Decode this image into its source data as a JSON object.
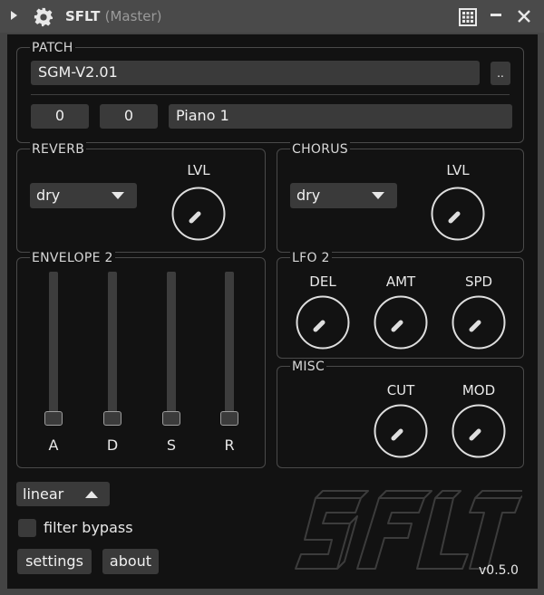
{
  "window": {
    "title": "SFLT",
    "subtitle": "(Master)"
  },
  "patch": {
    "label": "PATCH",
    "name": "SGM-V2.01",
    "browse_label": "..",
    "bank": "0",
    "program": "0",
    "preset_name": "Piano 1"
  },
  "reverb": {
    "label": "REVERB",
    "mode": "dry",
    "knob_label": "LVL"
  },
  "chorus": {
    "label": "CHORUS",
    "mode": "dry",
    "knob_label": "LVL"
  },
  "envelope": {
    "label": "ENVELOPE 2",
    "sliders": [
      {
        "label": "A",
        "value": 0
      },
      {
        "label": "D",
        "value": 0
      },
      {
        "label": "S",
        "value": 0
      },
      {
        "label": "R",
        "value": 0
      }
    ],
    "curve": "linear"
  },
  "lfo": {
    "label": "LFO 2",
    "knobs": [
      "DEL",
      "AMT",
      "SPD"
    ]
  },
  "misc": {
    "label": "MISC",
    "knobs": [
      "CUT",
      "MOD"
    ]
  },
  "footer": {
    "filter_bypass": "filter bypass",
    "filter_bypass_checked": false,
    "settings": "settings",
    "about": "about",
    "version": "v0.5.0",
    "logo_text": "SFLT"
  },
  "colors": {
    "background": "#121212",
    "control": "#3a3a3a",
    "border": "#4a4a4a",
    "text": "#e8e8e8"
  }
}
